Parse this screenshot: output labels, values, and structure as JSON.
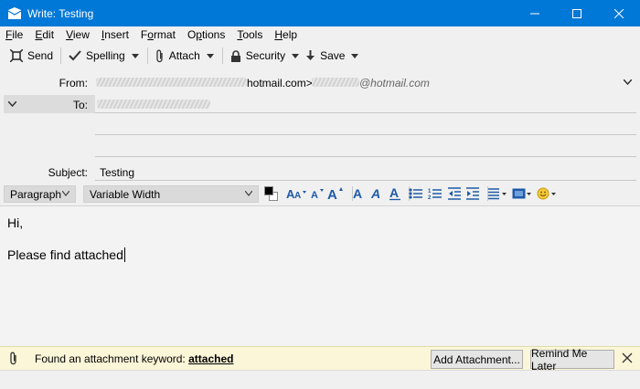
{
  "window": {
    "title": "Write: Testing",
    "accent_color": "#0078d7"
  },
  "menu": {
    "items": [
      {
        "key": "F",
        "rest": "ile"
      },
      {
        "key": "E",
        "rest": "dit"
      },
      {
        "key": "V",
        "rest": "iew"
      },
      {
        "key": "I",
        "rest": "nsert"
      },
      {
        "pre": "F",
        "key": "o",
        "rest": "rmat"
      },
      {
        "pre": "O",
        "key": "p",
        "rest": "tions"
      },
      {
        "key": "T",
        "rest": "ools"
      },
      {
        "key": "H",
        "rest": "elp"
      }
    ]
  },
  "toolbar": {
    "send_label": "Send",
    "spelling_label": "Spelling",
    "attach_label": "Attach",
    "security_label": "Security",
    "save_label": "Save"
  },
  "headers": {
    "from_label": "From:",
    "from_value_visible": "hotmail.com>",
    "from_value_visible_2": "@hotmail.com",
    "to_label": "To:",
    "subject_label": "Subject:",
    "subject_value": "Testing"
  },
  "format": {
    "paragraph_select": "Paragraph",
    "font_select": "Variable Width",
    "text_color": "#000000"
  },
  "body": {
    "line1": "Hi,",
    "line2": "Please find attached"
  },
  "notification": {
    "message": "Found an attachment keyword:",
    "keyword": "attached",
    "add_attachment_label": "Add Attachment...",
    "remind_later_label": "Remind Me Later"
  }
}
